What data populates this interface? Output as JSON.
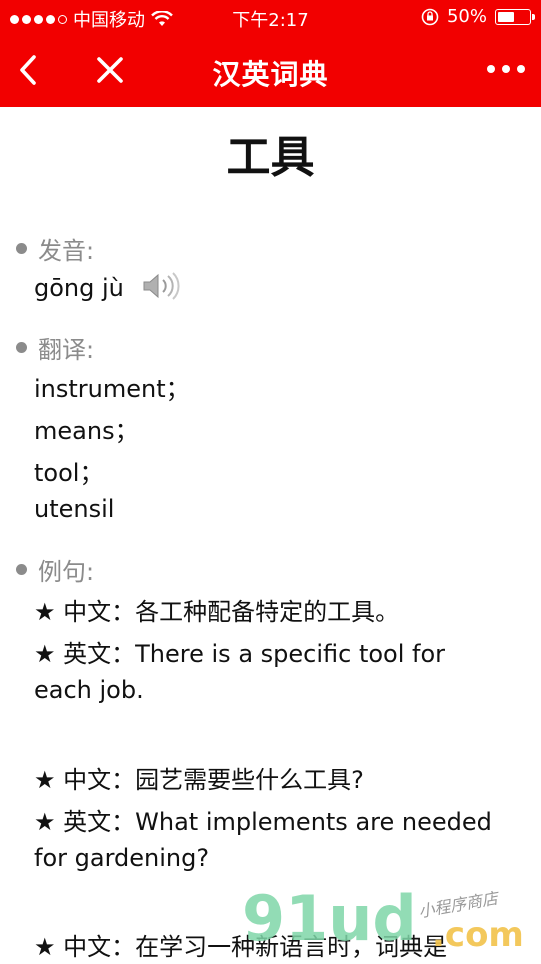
{
  "status_bar": {
    "carrier": "中国移动",
    "time": "下午2:17",
    "battery_percent": "50%",
    "signal_bars": 4
  },
  "navbar": {
    "title": "汉英词典",
    "back_icon": "chevron-left-icon",
    "close_icon": "close-icon",
    "more_icon": "more-dots-icon"
  },
  "word": {
    "title": "工具"
  },
  "pronunciation": {
    "label": "发音:",
    "pinyin": "gōng jù",
    "audio_icon": "speaker-icon"
  },
  "translation": {
    "label": "翻译:",
    "items": [
      "instrument；",
      "means；",
      "tool；",
      "utensil"
    ]
  },
  "examples": {
    "label": "例句:",
    "lines": [
      "★ 中文：各工种配备特定的工具。",
      "★ 英文：There is a specific tool for",
      "each job.",
      "★ 中文：园艺需要些什么工具?",
      "★ 英文：What implements are needed",
      "for gardening?",
      "★ 中文：在学习一种新语言时，词典是"
    ]
  },
  "watermark": {
    "brand": "91ud",
    "suffix": ".com",
    "tagline": "小程序商店"
  },
  "colors": {
    "header_red": "#f20000",
    "label_gray": "#8b8b8b",
    "text": "#111111"
  }
}
